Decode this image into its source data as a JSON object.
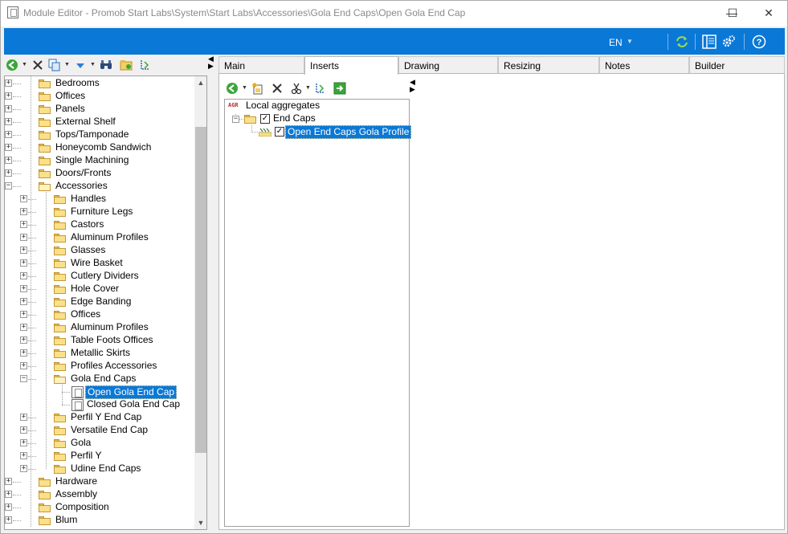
{
  "window": {
    "title": "Module Editor - Promob Start Labs\\System\\Start Labs\\Accessories\\Gola End Caps\\Open Gola End Cap",
    "minimize_glyph": "—",
    "maximize_glyph": "☐",
    "close_glyph": "✕"
  },
  "header": {
    "language": "EN"
  },
  "tree": {
    "items": [
      {
        "label": "Bedrooms",
        "level": 0
      },
      {
        "label": "Offices",
        "level": 0
      },
      {
        "label": "Panels",
        "level": 0
      },
      {
        "label": "External Shelf",
        "level": 0
      },
      {
        "label": "Tops/Tamponade",
        "level": 0
      },
      {
        "label": "Honeycomb Sandwich",
        "level": 0
      },
      {
        "label": "Single Machining",
        "level": 0
      },
      {
        "label": "Doors/Fronts",
        "level": 0
      },
      {
        "label": "Accessories",
        "level": 0,
        "open": true
      },
      {
        "label": "Handles",
        "level": 1
      },
      {
        "label": "Furniture Legs",
        "level": 1
      },
      {
        "label": "Castors",
        "level": 1
      },
      {
        "label": "Aluminum Profiles",
        "level": 1
      },
      {
        "label": "Glasses",
        "level": 1
      },
      {
        "label": "Wire Basket",
        "level": 1
      },
      {
        "label": "Cutlery Dividers",
        "level": 1
      },
      {
        "label": "Hole Cover",
        "level": 1
      },
      {
        "label": "Edge Banding",
        "level": 1
      },
      {
        "label": "Offices",
        "level": 1
      },
      {
        "label": "Aluminum Profiles",
        "level": 1
      },
      {
        "label": "Table Foots Offices",
        "level": 1
      },
      {
        "label": "Metallic Skirts",
        "level": 1
      },
      {
        "label": "Profiles Accessories",
        "level": 1
      },
      {
        "label": "Gola End Caps",
        "level": 1,
        "open": true
      },
      {
        "label": "Open Gola End Cap",
        "level": 2,
        "selected": true
      },
      {
        "label": "Closed Gola End Cap",
        "level": 2
      },
      {
        "label": "Perfil Y End Cap",
        "level": 1
      },
      {
        "label": "Versatile End Cap",
        "level": 1
      },
      {
        "label": "Gola",
        "level": 1
      },
      {
        "label": "Perfil Y",
        "level": 1
      },
      {
        "label": "Udine End Caps",
        "level": 1
      },
      {
        "label": "Hardware",
        "level": 0
      },
      {
        "label": "Assembly",
        "level": 0
      },
      {
        "label": "Composition",
        "level": 0
      },
      {
        "label": "Blum",
        "level": 0
      }
    ]
  },
  "tabs": [
    {
      "label": "Main"
    },
    {
      "label": "Inserts",
      "active": true
    },
    {
      "label": "Drawing"
    },
    {
      "label": "Resizing"
    },
    {
      "label": "Notes"
    },
    {
      "label": "Builder"
    }
  ],
  "inserts": {
    "root_badge": "AGR",
    "root_label": "Local aggregates",
    "group_label": "End Caps",
    "item_label": "Open End Caps Gola Profile"
  },
  "colors": {
    "accent": "#0a78d7",
    "selection": "#0a78d7",
    "folder": "#fbe08a"
  }
}
